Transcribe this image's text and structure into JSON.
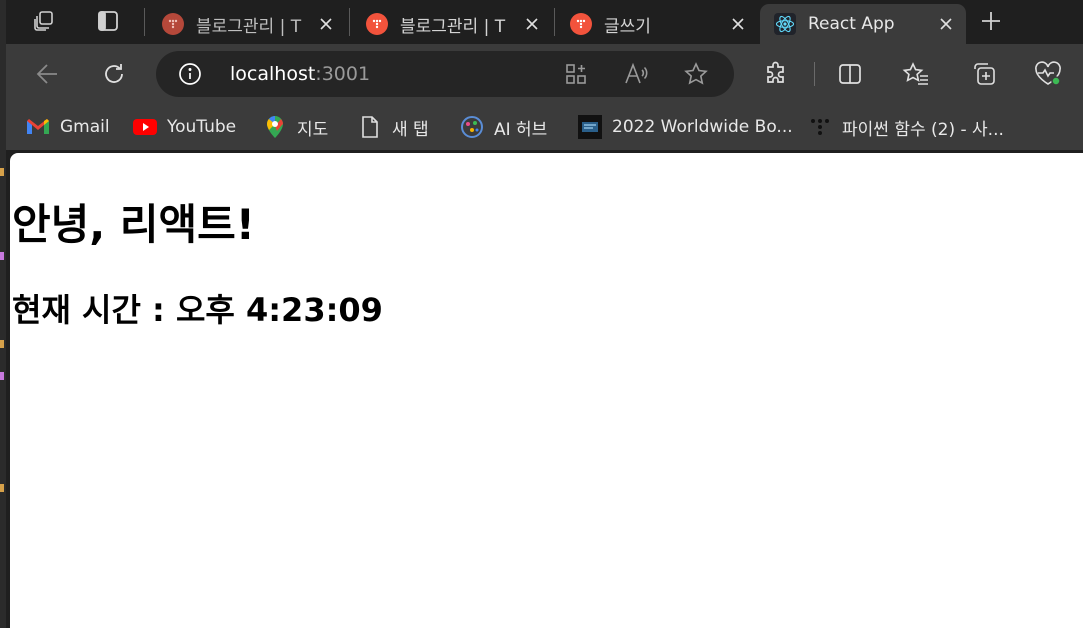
{
  "tabs": [
    {
      "title": "블로그관리 | T",
      "favicon": "tistory-icon",
      "active": false
    },
    {
      "title": "블로그관리 | T",
      "favicon": "tistory-icon",
      "active": false
    },
    {
      "title": "글쓰기",
      "favicon": "tistory-icon",
      "active": false
    },
    {
      "title": "React App",
      "favicon": "react-icon",
      "active": true
    }
  ],
  "address": {
    "host": "localhost",
    "port": ":3001"
  },
  "bookmarks": [
    {
      "label": "Gmail",
      "icon": "gmail-icon"
    },
    {
      "label": "YouTube",
      "icon": "youtube-icon"
    },
    {
      "label": "지도",
      "icon": "maps-icon"
    },
    {
      "label": "새 탭",
      "icon": "page-icon"
    },
    {
      "label": "AI 허브",
      "icon": "ai-hub-icon"
    },
    {
      "label": "2022 Worldwide Bo...",
      "icon": "box-office-icon"
    },
    {
      "label": "파이썬 함수 (2) - 사...",
      "icon": "dots-icon"
    }
  ],
  "page": {
    "heading": "안녕, 리액트!",
    "time_text": "현재 시간 : 오후 4:23:09"
  },
  "colors": {
    "tistory": "#f2533c",
    "tistory_dim": "#b5483a",
    "react": "#61dafb"
  }
}
